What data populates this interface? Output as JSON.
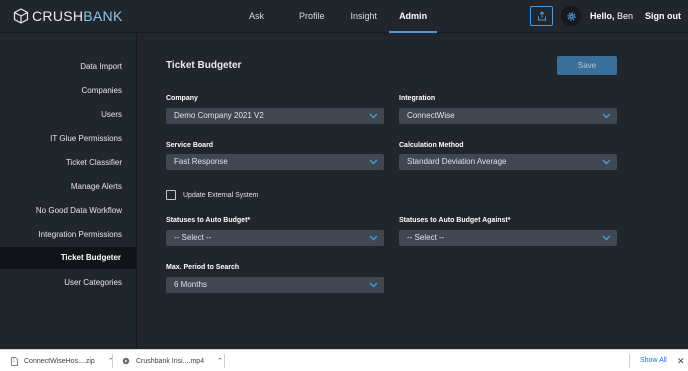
{
  "header": {
    "logo_prefix": "CRUSH",
    "logo_suffix": "BANK",
    "nav": [
      {
        "label": "Ask"
      },
      {
        "label": "Profile"
      },
      {
        "label": "Insight"
      },
      {
        "label": "Admin"
      }
    ],
    "hello_prefix": "Hello,",
    "user_name": "Ben",
    "sign_out": "Sign out",
    "accent": "#4e9ad8"
  },
  "sidebar": {
    "items": [
      {
        "label": "Data Import"
      },
      {
        "label": "Companies"
      },
      {
        "label": "Users"
      },
      {
        "label": "IT Glue Permissions"
      },
      {
        "label": "Ticket Classifier"
      },
      {
        "label": "Manage Alerts"
      },
      {
        "label": "No Good Data Workflow"
      },
      {
        "label": "Integration Permissions"
      },
      {
        "label": "Ticket Budgeter"
      },
      {
        "label": "User Categories"
      }
    ],
    "active": "Ticket Budgeter"
  },
  "main": {
    "title": "Ticket Budgeter",
    "save_label": "Save",
    "company": {
      "label": "Company",
      "value": "Demo Company 2021 V2"
    },
    "integration": {
      "label": "Integration",
      "value": "ConnectWise"
    },
    "service_board": {
      "label": "Service Board",
      "value": "Fast Response"
    },
    "calculation_method": {
      "label": "Calculation Method",
      "value": "Standard Deviation Average"
    },
    "update_external": {
      "label": "Update External System",
      "checked": false
    },
    "statuses_budget": {
      "label": "Statuses to Auto Budget*",
      "value": "-- Select --"
    },
    "statuses_against": {
      "label": "Statuses to Auto Budget Against*",
      "value": "-- Select --"
    },
    "max_period": {
      "label": "Max. Period to Search",
      "value": "6 Months"
    }
  },
  "downloads": {
    "items": [
      {
        "name": "ConnectWiseHos....zip"
      },
      {
        "name": "Crushbank Insi....mp4"
      }
    ],
    "show_all": "Show All"
  }
}
